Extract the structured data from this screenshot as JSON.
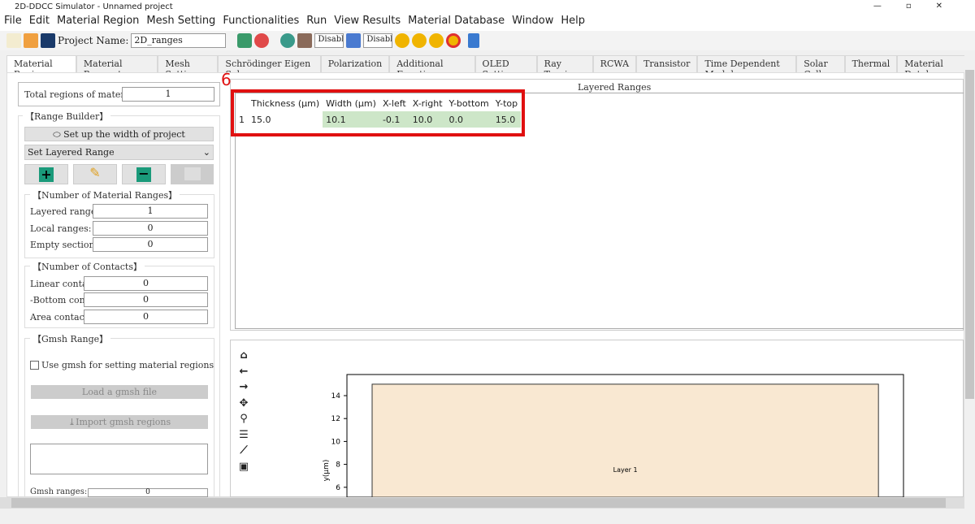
{
  "window": {
    "title": "2D-DDCC Simulator - Unnamed project"
  },
  "menu": [
    "File",
    "Edit",
    "Material Region",
    "Mesh Setting",
    "Functionalities",
    "Run",
    "View Results",
    "Material Database",
    "Window",
    "Help"
  ],
  "toolbar": {
    "project_label": "Project Name:",
    "project_name": "2D_ranges",
    "disabled1": "Disabled",
    "disabled2": "Disabled"
  },
  "tabs": [
    "Material Region",
    "Material Parameter",
    "Mesh Setting",
    "Schrödinger Eigen Solver",
    "Polarization",
    "Additional Functions",
    "OLED Setting",
    "Ray Tracing",
    "RCWA",
    "Transistor",
    "Time Dependent Module",
    "Solar Cell",
    "Thermal",
    "Material Database"
  ],
  "left": {
    "total_label": "Total regions of materials:",
    "total_value": "1",
    "range_builder": "【Range Builder】",
    "setup_width": "Set up the width of project",
    "range_select": "Set Layered Range",
    "num_ranges": "【Number of Material Ranges】",
    "layered_label": "Layered ranges:",
    "layered_value": "1",
    "local_label": "Local ranges:",
    "local_value": "0",
    "empty_label": "Empty sections:",
    "empty_value": "0",
    "contacts": "【Number of Contacts】",
    "linear_label": "Linear contact",
    "linear_value": "0",
    "bottom_label": "-Bottom conta",
    "bottom_value": "0",
    "area_label": "Area contacts:",
    "area_value": "0",
    "gmsh": "【Gmsh Range】",
    "use_gmsh": "Use gmsh for setting material regions",
    "load_gmsh": "Load a gmsh file",
    "import_gmsh": "Import gmsh regions",
    "gmsh_ranges_label": "Gmsh ranges:",
    "gmsh_ranges_value": "0"
  },
  "annotation": "6",
  "table": {
    "title": "Layered Ranges",
    "headers": [
      "Thickness (µm)",
      "Width (µm)",
      "X-left",
      "X-right",
      "Y-bottom",
      "Y-top"
    ],
    "rows": [
      {
        "index": "1",
        "cells": [
          "15.0",
          "10.1",
          "-0.1",
          "10.0",
          "0.0",
          "15.0"
        ]
      }
    ]
  },
  "chart_data": {
    "type": "rect",
    "ylabel": "y(µm)",
    "yticks": [
      "14",
      "12",
      "10",
      "8",
      "6"
    ],
    "layers": [
      {
        "name": "Layer 1",
        "x_left": -0.1,
        "x_right": 10.0,
        "y_bottom": 0.0,
        "y_top": 15.0,
        "color": "#f9e8d2"
      }
    ]
  },
  "plot_toolbar": [
    "home-icon",
    "back-icon",
    "forward-icon",
    "pan-icon",
    "zoom-icon",
    "configure-icon",
    "edit-curves-icon",
    "save-icon"
  ]
}
